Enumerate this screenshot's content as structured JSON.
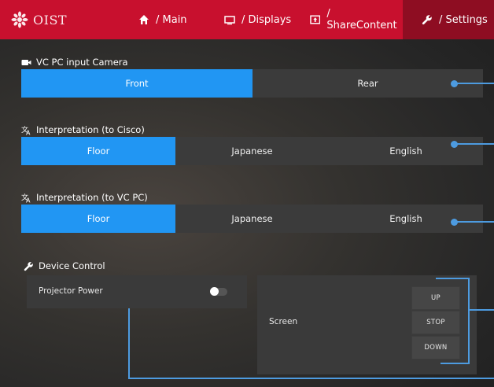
{
  "header": {
    "logo_text": "OIST",
    "nav": [
      {
        "label": "/ Main",
        "icon": "home-icon"
      },
      {
        "label": "/ Displays",
        "icon": "display-icon"
      },
      {
        "label": "/ ShareContent",
        "icon": "share-content-icon"
      },
      {
        "label": "/ Settings",
        "icon": "wrench-icon",
        "active": true
      }
    ]
  },
  "camera": {
    "title": "VC PC input Camera",
    "options": [
      "Front",
      "Rear"
    ],
    "selected": "Front"
  },
  "interp_cisco": {
    "title": "Interpretation (to Cisco)",
    "options": [
      "Floor",
      "Japanese",
      "English"
    ],
    "selected": "Floor"
  },
  "interp_vcpc": {
    "title": "Interpretation (to VC PC)",
    "options": [
      "Floor",
      "Japanese",
      "English"
    ],
    "selected": "Floor"
  },
  "device": {
    "title": "Device Control",
    "projector_label": "Projector Power",
    "projector_on": false,
    "screen_label": "Screen",
    "screen_buttons": [
      "UP",
      "STOP",
      "DOWN"
    ]
  },
  "colors": {
    "header": "#c8102e",
    "header_active": "#8e0d22",
    "selected": "#2196f3",
    "connector": "#4d9be0"
  }
}
